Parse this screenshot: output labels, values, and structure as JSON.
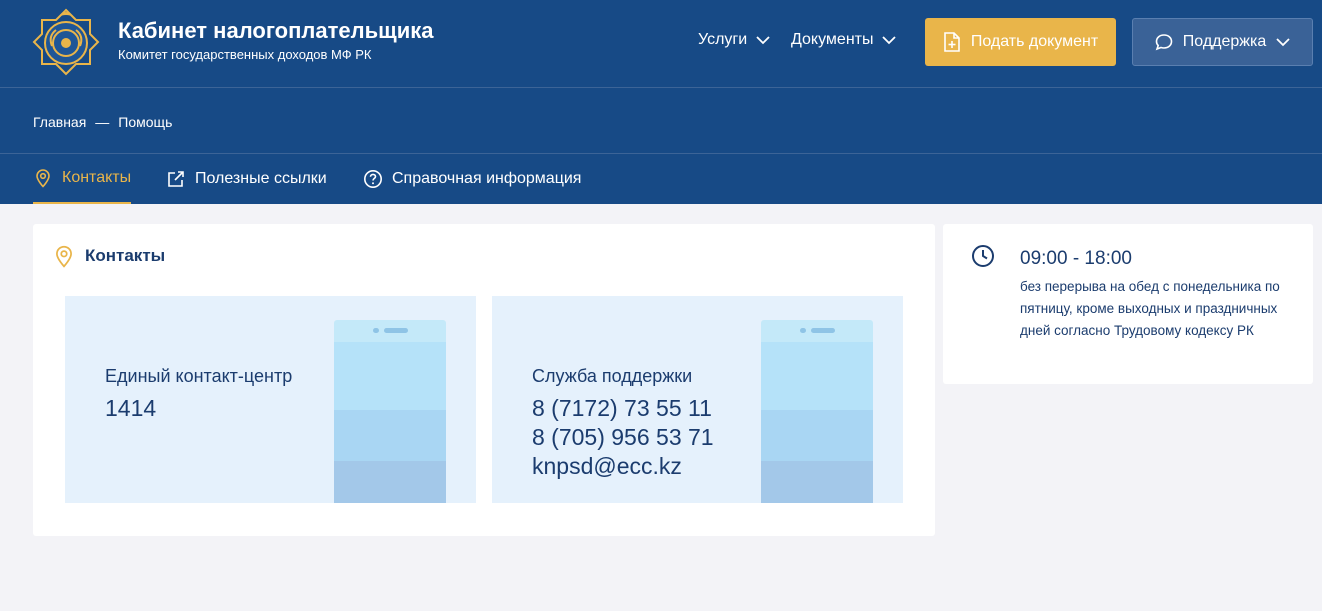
{
  "header": {
    "title": "Кабинет налогоплательщика",
    "subtitle": "Комитет государственных доходов МФ РК",
    "nav": [
      {
        "label": "Услуги"
      },
      {
        "label": "Документы"
      }
    ],
    "submit_label": "Подать документ",
    "support_label": "Поддержка"
  },
  "breadcrumb": {
    "home": "Главная",
    "separator": "—",
    "current": "Помощь"
  },
  "tabs": [
    {
      "label": "Контакты",
      "active": true
    },
    {
      "label": "Полезные ссылки",
      "active": false
    },
    {
      "label": "Справочная информация",
      "active": false
    }
  ],
  "contacts": {
    "title": "Контакты",
    "cards": [
      {
        "label": "Единый контакт-центр",
        "lines": [
          "1414"
        ]
      },
      {
        "label": "Служба поддержки",
        "lines": [
          "8 (7172) 73 55 11",
          "8 (705) 956 53 71",
          "knpsd@ecc.kz"
        ]
      }
    ]
  },
  "schedule": {
    "hours": "09:00 - 18:00",
    "note": "без перерыва на обед с понедельника по пятницу, кроме выходных и праздничных дней согласно Трудовому кодексу РК"
  },
  "colors": {
    "header_bg": "#174a86",
    "accent": "#e9b54a",
    "text": "#1b3c6e",
    "page_bg": "#f3f3f7",
    "contact_bg": "#e5f1fc"
  }
}
